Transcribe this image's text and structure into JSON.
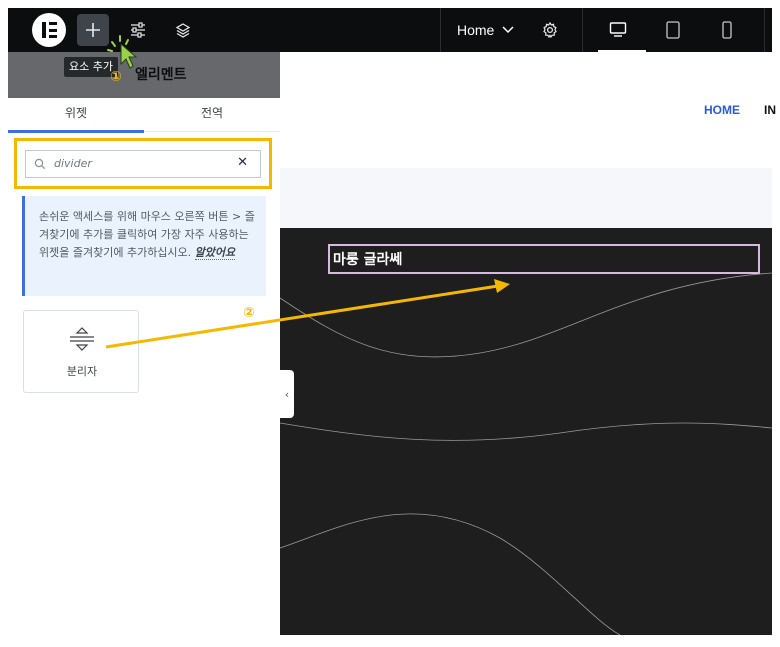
{
  "topbar": {
    "logo": "elementor-logo",
    "add_element_icon": "plus-icon",
    "site_settings_icon": "sliders-icon",
    "structure_icon": "layers-icon",
    "page_name": "Home",
    "page_dropdown_icon": "chevron-down-icon",
    "page_settings_icon": "gear-icon",
    "devices": [
      "desktop-icon",
      "tablet-icon",
      "mobile-icon"
    ]
  },
  "panel": {
    "tooltip": "요소 추가",
    "title": "엘리멘트",
    "tabs": [
      {
        "label": "위젯",
        "active": true
      },
      {
        "label": "전역",
        "active": false
      }
    ],
    "search": {
      "value": "divider",
      "clear_icon": "close-icon"
    },
    "notice": {
      "text": "손쉬운 액세스를 위해 마우스 오른쪽 버튼 > 즐겨찾기에 추가를 클릭하여 가장 자주 사용하는 위젯을 즐겨찾기에 추가하십시오.",
      "link": "알았어요"
    },
    "widgets": [
      {
        "label": "분리자",
        "icon": "divider-icon"
      }
    ],
    "collapse_icon": "chevron-left-icon"
  },
  "canvas": {
    "nav": {
      "active": "HOME",
      "next": "IN"
    },
    "heading": "마룽 글라쎄"
  },
  "annotations": {
    "step1": "①",
    "step2": "②",
    "highlight_color": "#f5b800"
  }
}
